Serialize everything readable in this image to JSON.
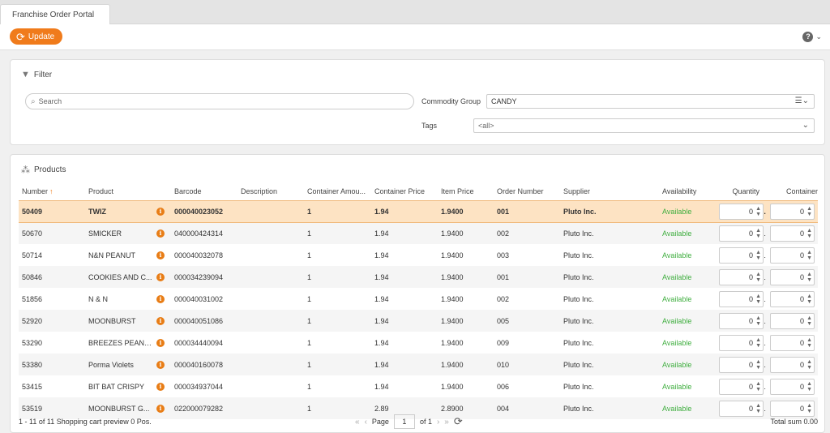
{
  "tab": {
    "title": "Franchise Order Portal"
  },
  "toolbar": {
    "update_label": "Update",
    "help_icon": "help-icon"
  },
  "filter": {
    "title": "Filter",
    "search_placeholder": "Search",
    "commodity_label": "Commodity Group",
    "commodity_value": "CANDY",
    "tags_label": "Tags",
    "tags_value": "<all>"
  },
  "products": {
    "title": "Products",
    "columns": [
      "Number",
      "Product",
      "",
      "Barcode",
      "Description",
      "Container Amou...",
      "Container Price",
      "Item Price",
      "Order Number",
      "Supplier",
      "Availability",
      "Quantity",
      "Container"
    ],
    "rows": [
      {
        "number": "50409",
        "product": "TWIZ",
        "barcode": "000040023052",
        "description": "",
        "container_amount": "1",
        "container_price": "1.94",
        "item_price": "1.9400",
        "order_number": "001",
        "supplier": "Pluto Inc.",
        "availability": "Available",
        "quantity": "0",
        "container": "0"
      },
      {
        "number": "50670",
        "product": "SMICKER",
        "barcode": "040000424314",
        "description": "",
        "container_amount": "1",
        "container_price": "1.94",
        "item_price": "1.9400",
        "order_number": "002",
        "supplier": "Pluto Inc.",
        "availability": "Available",
        "quantity": "0",
        "container": "0"
      },
      {
        "number": "50714",
        "product": "N&N PEANUT",
        "barcode": "000040032078",
        "description": "",
        "container_amount": "1",
        "container_price": "1.94",
        "item_price": "1.9400",
        "order_number": "003",
        "supplier": "Pluto Inc.",
        "availability": "Available",
        "quantity": "0",
        "container": "0"
      },
      {
        "number": "50846",
        "product": "COOKIES AND C...",
        "barcode": "000034239094",
        "description": "",
        "container_amount": "1",
        "container_price": "1.94",
        "item_price": "1.9400",
        "order_number": "001",
        "supplier": "Pluto Inc.",
        "availability": "Available",
        "quantity": "0",
        "container": "0"
      },
      {
        "number": "51856",
        "product": "N & N",
        "barcode": "000040031002",
        "description": "",
        "container_amount": "1",
        "container_price": "1.94",
        "item_price": "1.9400",
        "order_number": "002",
        "supplier": "Pluto Inc.",
        "availability": "Available",
        "quantity": "0",
        "container": "0"
      },
      {
        "number": "52920",
        "product": "MOONBURST",
        "barcode": "000040051086",
        "description": "",
        "container_amount": "1",
        "container_price": "1.94",
        "item_price": "1.9400",
        "order_number": "005",
        "supplier": "Pluto Inc.",
        "availability": "Available",
        "quantity": "0",
        "container": "0"
      },
      {
        "number": "53290",
        "product": "BREEZES PEANU...",
        "barcode": "000034440094",
        "description": "",
        "container_amount": "1",
        "container_price": "1.94",
        "item_price": "1.9400",
        "order_number": "009",
        "supplier": "Pluto Inc.",
        "availability": "Available",
        "quantity": "0",
        "container": "0"
      },
      {
        "number": "53380",
        "product": "Porma Violets",
        "barcode": "000040160078",
        "description": "",
        "container_amount": "1",
        "container_price": "1.94",
        "item_price": "1.9400",
        "order_number": "010",
        "supplier": "Pluto Inc.",
        "availability": "Available",
        "quantity": "0",
        "container": "0"
      },
      {
        "number": "53415",
        "product": "BIT BAT CRISPY",
        "barcode": "000034937044",
        "description": "",
        "container_amount": "1",
        "container_price": "1.94",
        "item_price": "1.9400",
        "order_number": "006",
        "supplier": "Pluto Inc.",
        "availability": "Available",
        "quantity": "0",
        "container": "0"
      },
      {
        "number": "53519",
        "product": "MOONBURST G...",
        "barcode": "022000079282",
        "description": "",
        "container_amount": "1",
        "container_price": "2.89",
        "item_price": "2.8900",
        "order_number": "004",
        "supplier": "Pluto Inc.",
        "availability": "Available",
        "quantity": "0",
        "container": "0"
      }
    ]
  },
  "footer": {
    "range": "1 - 11 of 11",
    "cart_label": "Shopping cart preview",
    "cart_value": "0 Pos.",
    "page_label": "Page",
    "page_value": "1",
    "page_of": "of 1",
    "total_label": "Total sum",
    "total_value": "0.00"
  },
  "colors": {
    "accent": "#f07b1b",
    "selected_row": "#fde3c3",
    "available": "#3fae3f"
  }
}
